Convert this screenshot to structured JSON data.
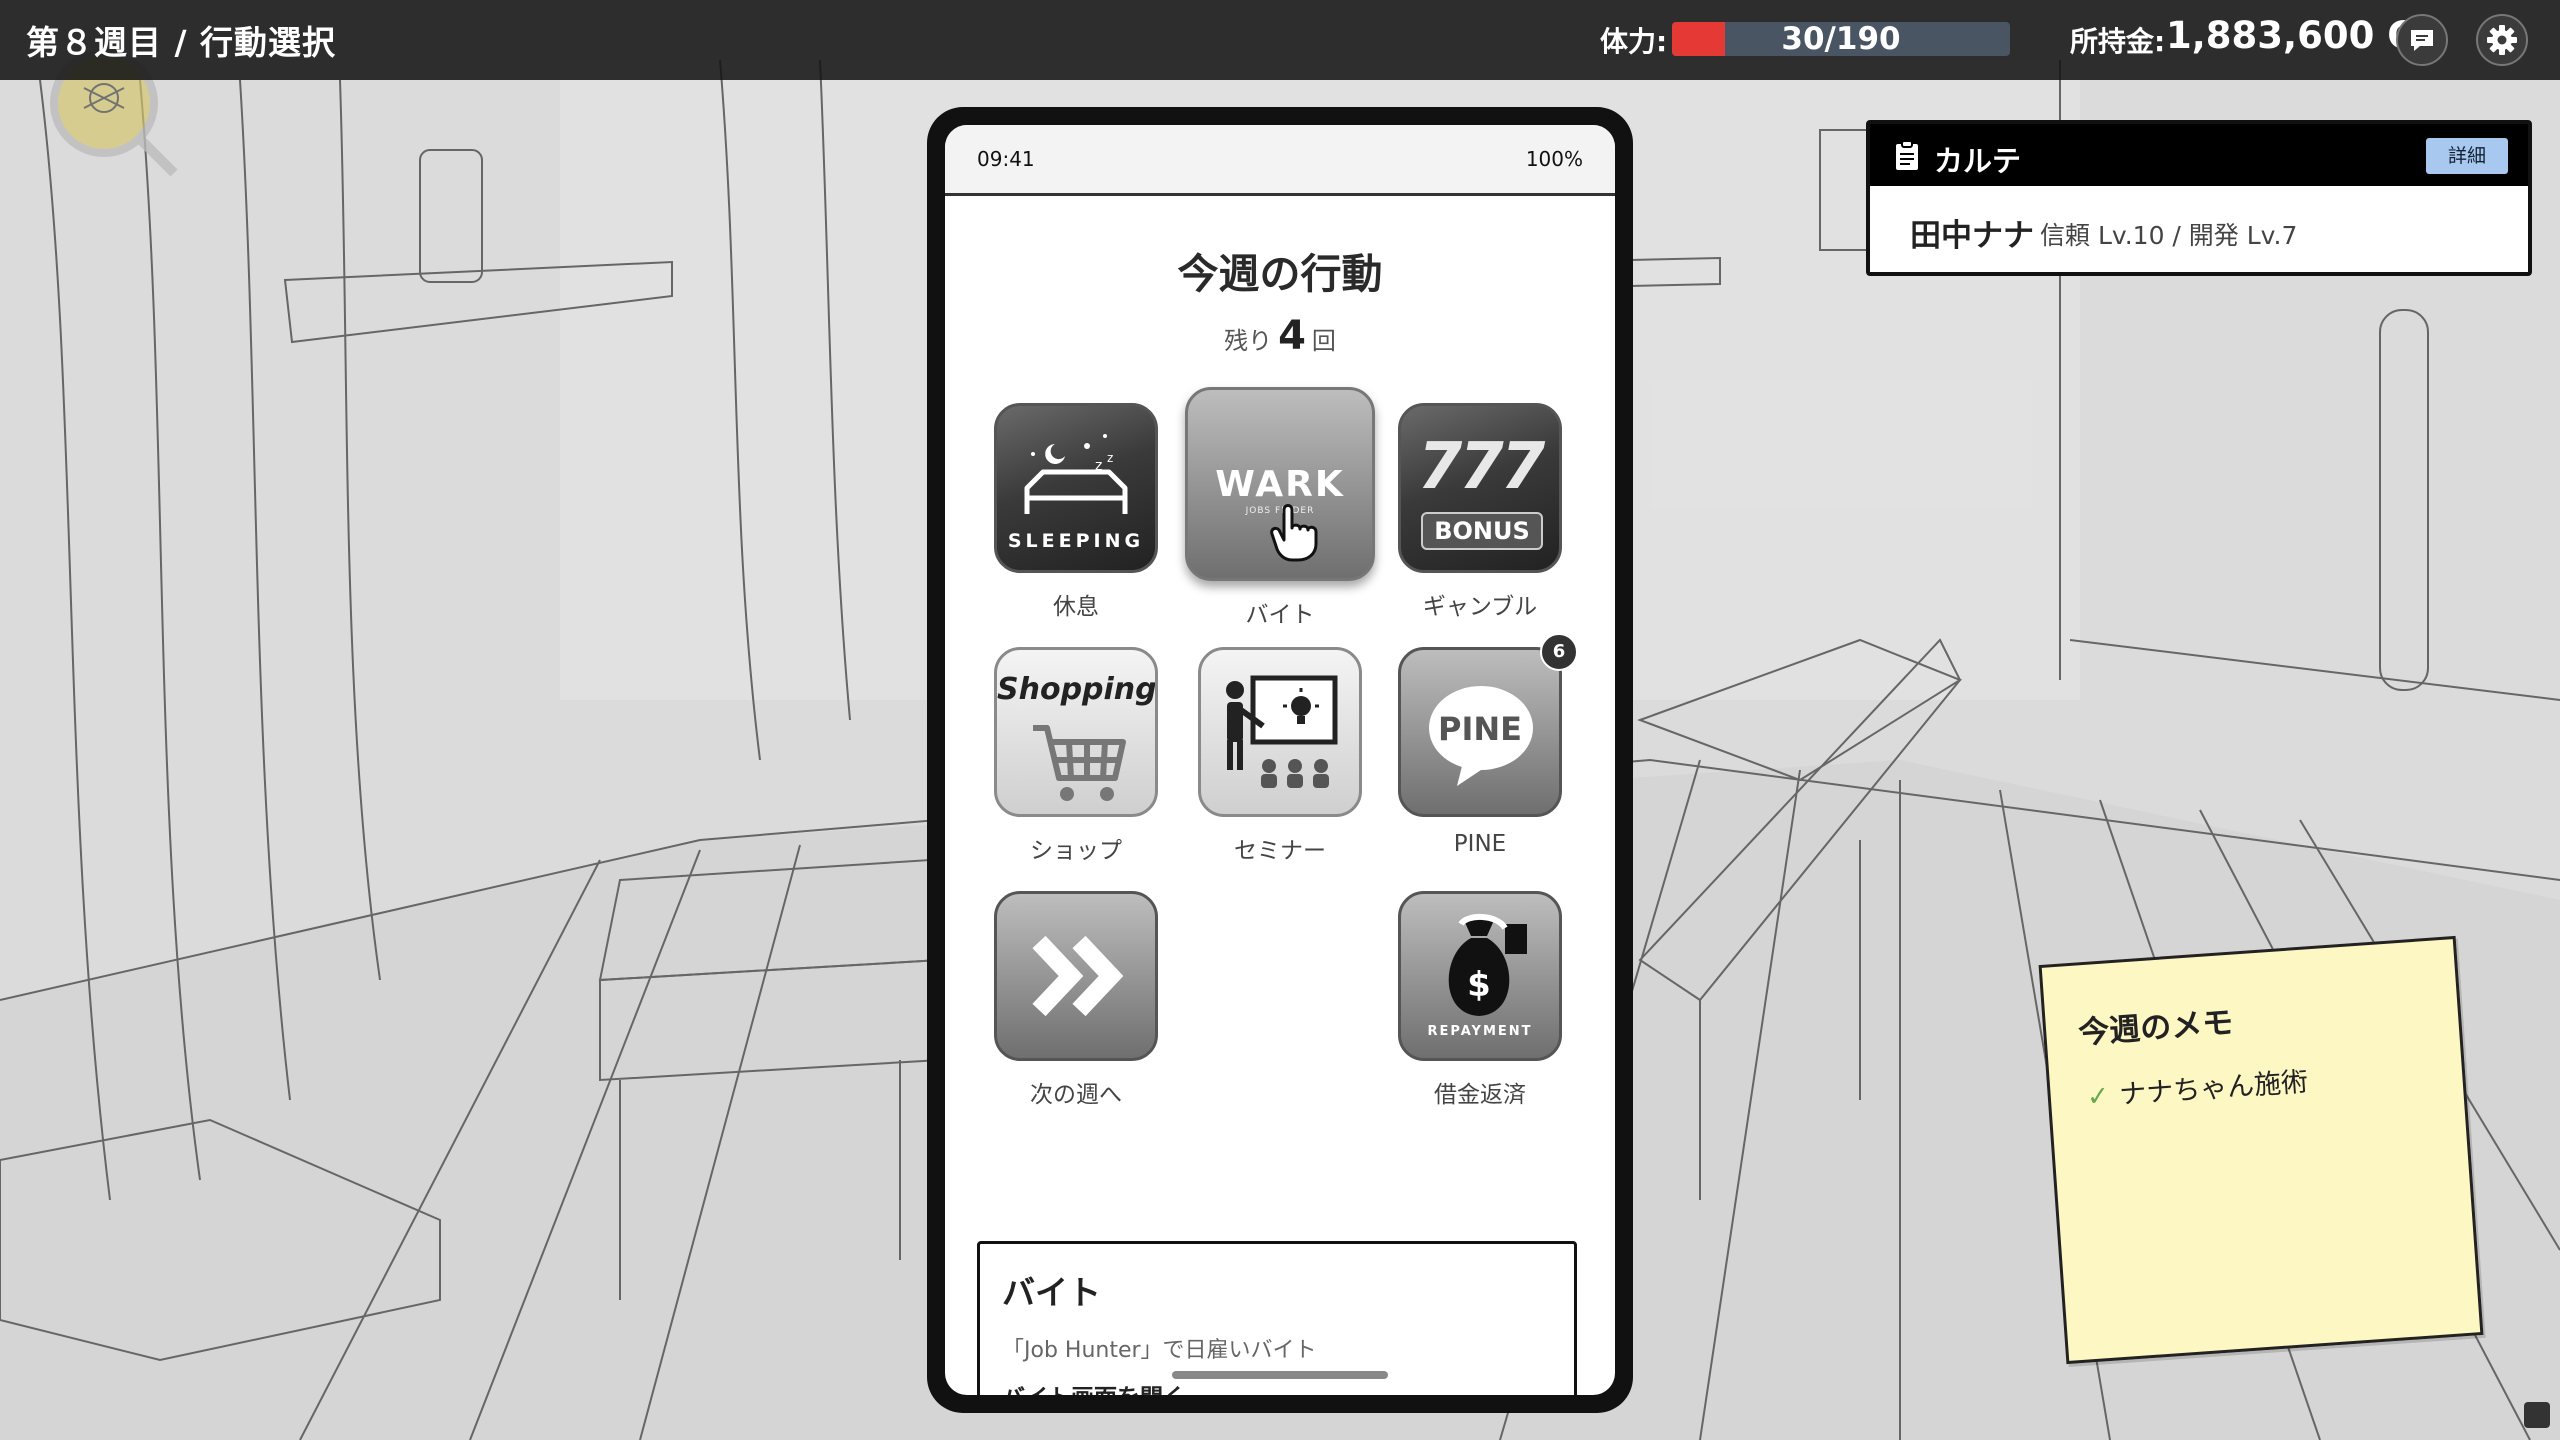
{
  "header": {
    "week_title": "第８週目 / 行動選択",
    "stamina_label": "体力:",
    "stamina_text": "30/190",
    "stamina_fraction": 0.158,
    "money_label": "所持金:",
    "money_value": "1,883,600 G",
    "chat_icon": "chat-bubble-icon",
    "settings_icon": "gear-icon"
  },
  "phone": {
    "time": "09:41",
    "battery": "100%",
    "title": "今週の行動",
    "remaining_prefix": "残り",
    "remaining_count": "4",
    "remaining_suffix": "回",
    "apps": {
      "sleep": {
        "icon_text": "SLEEPING",
        "label": "休息"
      },
      "work": {
        "icon_text": "WARK",
        "icon_sub": "JOBS FINDER",
        "label": "バイト"
      },
      "gamble": {
        "icon_text": "777",
        "icon_sub": "BONUS",
        "label": "ギャンブル"
      },
      "shop": {
        "icon_text": "Shopping",
        "label": "ショップ"
      },
      "seminar": {
        "label": "セミナー"
      },
      "pine": {
        "icon_text": "PINE",
        "label": "PINE",
        "badge": "6"
      },
      "next": {
        "label": "次の週へ"
      },
      "repay": {
        "icon_text": "REPAYMENT",
        "label": "借金返済"
      }
    },
    "description": {
      "title": "バイト",
      "text": "「Job Hunter」で日雇いバイト",
      "link": "バイト画面を開く"
    }
  },
  "karte": {
    "title": "カルテ",
    "detail_button": "詳細",
    "name": "田中ナナ",
    "stats": "信頼 Lv.10 / 開発 Lv.7"
  },
  "memo": {
    "title": "今週のメモ",
    "items": [
      {
        "text": "ナナちゃん施術",
        "checked": true
      }
    ]
  },
  "colors": {
    "stamina_fill": "#e53935",
    "stamina_track": "#4a5564",
    "memo_bg": "#fdf7c4",
    "detail_button": "#a9c8ef"
  }
}
